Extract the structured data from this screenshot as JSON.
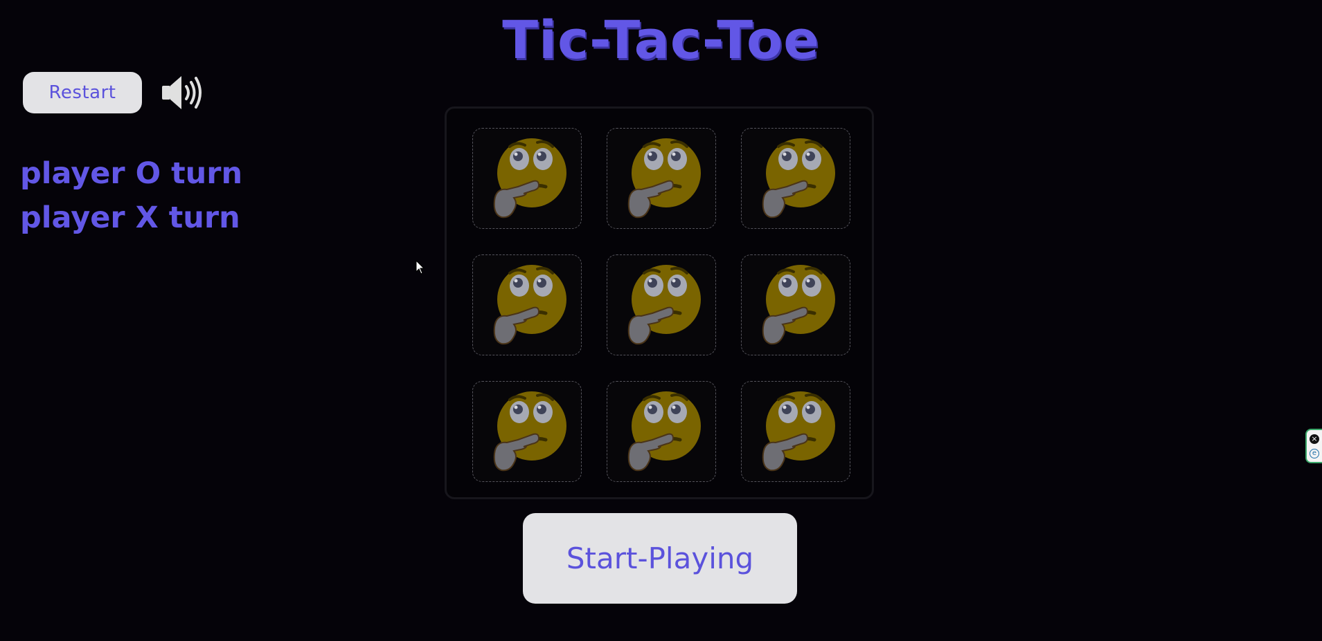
{
  "title": "Tic-Tac-Toe",
  "controls": {
    "restart_label": "Restart",
    "sound_icon": "speaker-volume-icon"
  },
  "turns": {
    "player_o": "player O turn",
    "player_x": "player X turn"
  },
  "board": {
    "cells": [
      {
        "icon": "thinking-face-icon"
      },
      {
        "icon": "thinking-face-icon"
      },
      {
        "icon": "thinking-face-icon"
      },
      {
        "icon": "thinking-face-icon"
      },
      {
        "icon": "thinking-face-icon"
      },
      {
        "icon": "thinking-face-icon"
      },
      {
        "icon": "thinking-face-icon"
      },
      {
        "icon": "thinking-face-icon"
      },
      {
        "icon": "thinking-face-icon"
      }
    ]
  },
  "start_label": "Start-Playing",
  "colors": {
    "accent": "#6257e6",
    "background": "#050309",
    "button_bg": "#e3e3e6"
  }
}
